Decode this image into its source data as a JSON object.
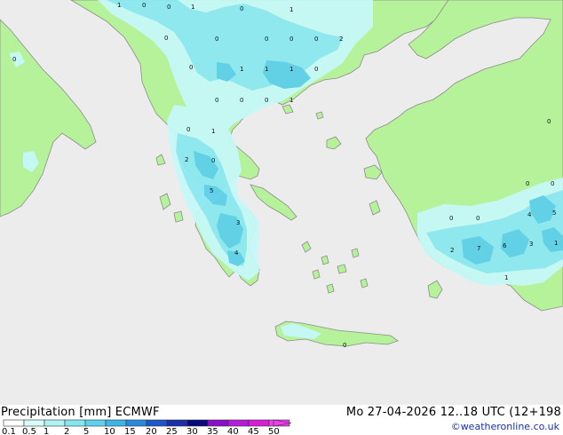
{
  "header": {
    "title_left": "Precipitation [mm]  ECMWF",
    "title_right": "Mo 27-04-2026 12..18 UTC (12+198",
    "credit": "©weatheronline.co.uk"
  },
  "legend": {
    "ticks": [
      "0.1",
      "0.5",
      "1",
      "2",
      "5",
      "10",
      "15",
      "20",
      "25",
      "30",
      "35",
      "40",
      "45",
      "50"
    ],
    "colors": [
      "#ffffff",
      "#d8fbfb",
      "#aef2f6",
      "#86e6f0",
      "#5ed2ec",
      "#3bb5e6",
      "#2a88dc",
      "#1c56c8",
      "#1c2fa8",
      "#070a7c",
      "#8a10c8",
      "#b41ed8",
      "#d61ed6",
      "#f03cf0"
    ]
  },
  "colors": {
    "sea": "#ececec",
    "land": "#b5f29a",
    "coast": "#8c8c8c",
    "precip_light": "#c6f8f8",
    "precip_medium": "#8ee8f2",
    "precip_heavy": "#5ecfea"
  },
  "map_labels": [
    {
      "text": "1"
    },
    {
      "text": "0"
    },
    {
      "text": "0"
    },
    {
      "text": "1"
    },
    {
      "text": "0"
    },
    {
      "text": "1"
    },
    {
      "text": "0"
    },
    {
      "text": "0"
    },
    {
      "text": "0"
    },
    {
      "text": "0"
    },
    {
      "text": "0"
    },
    {
      "text": "2"
    },
    {
      "text": "0"
    },
    {
      "text": "0"
    },
    {
      "text": "1"
    },
    {
      "text": "1"
    },
    {
      "text": "1"
    },
    {
      "text": "0"
    },
    {
      "text": "0"
    },
    {
      "text": "0"
    },
    {
      "text": "0"
    },
    {
      "text": "1"
    },
    {
      "text": "0"
    },
    {
      "text": "1"
    },
    {
      "text": "2"
    },
    {
      "text": "0"
    },
    {
      "text": "5"
    },
    {
      "text": "3"
    },
    {
      "text": "4"
    },
    {
      "text": "0"
    },
    {
      "text": "0"
    },
    {
      "text": "0"
    },
    {
      "text": "0"
    },
    {
      "text": "0"
    },
    {
      "text": "4"
    },
    {
      "text": "5"
    },
    {
      "text": "2"
    },
    {
      "text": "7"
    },
    {
      "text": "6"
    },
    {
      "text": "3"
    },
    {
      "text": "1"
    },
    {
      "text": "1"
    },
    {
      "text": "0"
    }
  ]
}
